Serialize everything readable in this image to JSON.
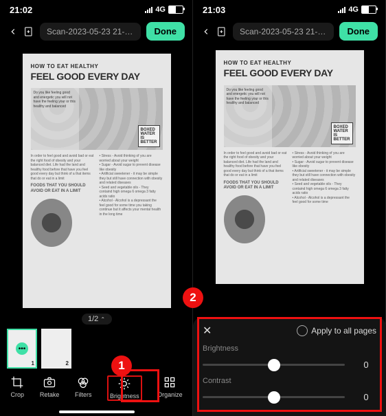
{
  "left": {
    "time": "21:02",
    "network": "4G",
    "filename": "Scan-2023-05-23 21-01-17",
    "done": "Done",
    "page": "1/2",
    "thumbs": [
      "1",
      "2"
    ],
    "tools": {
      "crop": "Crop",
      "retake": "Retake",
      "filters": "Filters",
      "brightness": "Brightness",
      "organize": "Organize"
    },
    "marker": "1"
  },
  "right": {
    "time": "21:03",
    "network": "4G",
    "filename": "Scan-2023-05-23 21-01-17",
    "done": "Done",
    "close": "✕",
    "apply_all": "Apply to all pages",
    "brightness_lbl": "Brightness",
    "brightness_val": "0",
    "contrast_lbl": "Contrast",
    "contrast_val": "0",
    "marker": "2"
  },
  "doc": {
    "pretitle": "HOW TO EAT HEALTHY",
    "title": "FEEL GOOD EVERY DAY",
    "badge": "BOXED\nWATER\nIS\nBETTER",
    "subhead": "FOODS THAT YOU SHOULD\nAVOID OR EAT IN A LIMIT"
  }
}
